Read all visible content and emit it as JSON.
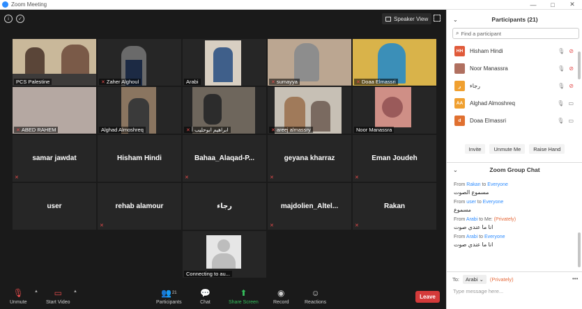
{
  "window": {
    "title": "Zoom Meeting",
    "controls": [
      "—",
      "□",
      "✕"
    ]
  },
  "colors": {
    "accent": "#2d8cff",
    "active_speaker": "#9be34d",
    "leave": "#d43a3a",
    "muted": "#e34b4b",
    "share": "#35c05c",
    "private": "#e66b3c"
  },
  "topbar": {
    "speaker_view_label": "Speaker View"
  },
  "tiles": [
    {
      "name": "PCS Palestine",
      "muted": false
    },
    {
      "name": "Zaher Alghoul",
      "muted": true
    },
    {
      "name": "Arabi",
      "muted": false
    },
    {
      "name": "sumayya",
      "muted": true
    },
    {
      "name": "Doaa Elmassri",
      "muted": true
    },
    {
      "name": "ABED RAHEM",
      "muted": true
    },
    {
      "name": "Alghad Almoshreq",
      "muted": false
    },
    {
      "name": "ابراهيم ابوحليب أ",
      "muted": true
    },
    {
      "name": "areej almassry",
      "muted": true
    },
    {
      "name": "Noor Manassra",
      "muted": false
    },
    {
      "name": "samar jawdat",
      "muted": true
    },
    {
      "name": "Hisham Hindi",
      "muted": false
    },
    {
      "name": "Bahaa_Alaqad-P...",
      "muted": true
    },
    {
      "name": "geyana kharraz",
      "muted": true
    },
    {
      "name": "Eman Joudeh",
      "muted": true
    },
    {
      "name": "user",
      "muted": false
    },
    {
      "name": "rehab alamour",
      "muted": true
    },
    {
      "name": "رجاء",
      "muted": false
    },
    {
      "name": "majdolien_Altel...",
      "muted": true
    },
    {
      "name": "Rakan",
      "muted": true
    },
    {
      "name": "Connecting to au...",
      "muted": false
    }
  ],
  "toolbar": {
    "unmute": "Unmute",
    "start_video": "Start Video",
    "participants": "Participants",
    "participants_count": "21",
    "chat": "Chat",
    "share_screen": "Share Screen",
    "record": "Record",
    "reactions": "Reactions",
    "leave": "Leave"
  },
  "participants_panel": {
    "title": "Participants (21)",
    "search_placeholder": "Find a participant",
    "list": [
      {
        "initials": "HH",
        "name": "Hisham Hindi",
        "avatar_color": "#e05a3a"
      },
      {
        "initials": "",
        "name": "Noor Manassra",
        "avatar_color": "#b07060"
      },
      {
        "initials": "ر",
        "name": "رجاء",
        "avatar_color": "#f0a030"
      },
      {
        "initials": "AA",
        "name": "Alghad Almoshreq",
        "avatar_color": "#f0a030"
      },
      {
        "initials": "d",
        "name": "Doaa Elmassri",
        "avatar_color": "#e07030"
      }
    ],
    "invite": "Invite",
    "unmute_me": "Unmute Me",
    "raise_hand": "Raise Hand"
  },
  "chat_panel": {
    "title": "Zoom Group Chat",
    "messages": [
      {
        "from": "Rakan",
        "to": "Everyone",
        "private": "",
        "text": "مسموع الصوت"
      },
      {
        "from": "user",
        "to": "Everyone",
        "private": "",
        "text": "مسموع"
      },
      {
        "from": "Arabi",
        "to": "Me:",
        "private": "(Privately)",
        "text": "انا ما عندي صوت"
      },
      {
        "from": "Arabi",
        "to": "Everyone",
        "private": "",
        "text": "انا ما عندي صوت"
      }
    ],
    "from_label": "From",
    "to_word": "to",
    "to_label": "To:",
    "to_value": "Arabi",
    "to_private": "(Privately)",
    "input_placeholder": "Type message here..."
  }
}
